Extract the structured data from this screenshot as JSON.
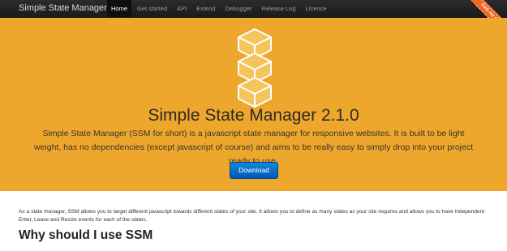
{
  "navbar": {
    "brand": "Simple State Manager",
    "items": [
      {
        "label": "Home",
        "active": true
      },
      {
        "label": "Get started",
        "active": false
      },
      {
        "label": "API",
        "active": false
      },
      {
        "label": "Extend",
        "active": false
      },
      {
        "label": "Debugger",
        "active": false
      },
      {
        "label": "Release Log",
        "active": false
      },
      {
        "label": "Licence",
        "active": false
      }
    ]
  },
  "ribbon": {
    "label": "Fork me on GitHub"
  },
  "hero": {
    "logo_icon": "stacked-cubes-logo",
    "title": "Simple State Manager 2.1.0",
    "lead": "Simple State Manager (SSM for short) is a javascript state manager for responsive websites. It is built to be light weight, has no dependencies (except javascript of course) and aims to be really easy to simply drop into your project ready to use.",
    "download_label": "Download"
  },
  "content": {
    "intro": "As a state manager, SSM allows you to target different javascript towards different states of your site. It allows you to define as many states as your site requires and allows you to have independent Enter, Leave and Resize events for each of the states.",
    "section_title": "Why should I use SSM"
  },
  "colors": {
    "navbar": "#1b1b1b",
    "hero": "#eea72d",
    "button": "#0a6fcc",
    "ribbon": "#f26522"
  }
}
